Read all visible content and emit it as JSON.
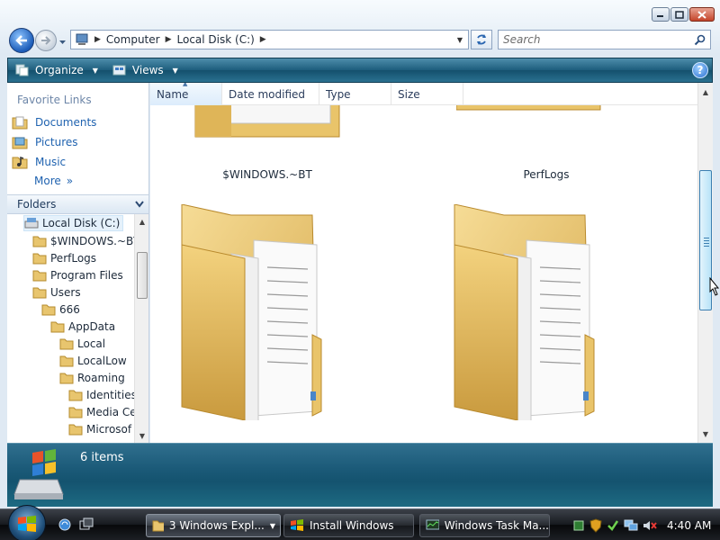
{
  "window": {
    "caption_buttons": [
      "minimize-icon",
      "maximize-icon",
      "close-icon"
    ]
  },
  "address_bar": {
    "crumbs": [
      "Computer",
      "Local Disk (C:)"
    ],
    "icon": "computer-icon"
  },
  "search": {
    "placeholder": "Search"
  },
  "command_bar": {
    "organize": "Organize",
    "views": "Views",
    "help": "?"
  },
  "nav_pane": {
    "favorites_title": "Favorite Links",
    "favorites": [
      {
        "label": "Documents",
        "icon": "documents-icon"
      },
      {
        "label": "Pictures",
        "icon": "pictures-icon"
      },
      {
        "label": "Music",
        "icon": "music-icon"
      }
    ],
    "more": "More",
    "folders_title": "Folders",
    "tree": [
      {
        "label": "Local Disk (C:)",
        "icon": "drive-icon",
        "level": 0,
        "selected": true
      },
      {
        "label": "$WINDOWS.~BT",
        "level": 1
      },
      {
        "label": "PerfLogs",
        "level": 1
      },
      {
        "label": "Program Files",
        "level": 1
      },
      {
        "label": "Users",
        "level": 1
      },
      {
        "label": "666",
        "level": 2
      },
      {
        "label": "AppData",
        "level": 3
      },
      {
        "label": "Local",
        "level": 4
      },
      {
        "label": "LocalLow",
        "level": 4
      },
      {
        "label": "Roaming",
        "level": 4
      },
      {
        "label": "Identities",
        "level": 5
      },
      {
        "label": "Media Ce",
        "level": 5
      },
      {
        "label": "Microsof",
        "level": 5
      }
    ]
  },
  "content": {
    "columns": [
      "Name",
      "Date modified",
      "Type",
      "Size"
    ],
    "sorted_column": "Name",
    "items": [
      {
        "label": "$WINDOWS.~BT"
      },
      {
        "label": "PerfLogs"
      },
      {
        "label": ""
      },
      {
        "label": ""
      }
    ]
  },
  "details_pane": {
    "count": "6 items"
  },
  "taskbar": {
    "buttons": [
      {
        "label": "3 Windows Expl...",
        "icon": "folder-icon",
        "active": true,
        "has_menu": true
      },
      {
        "label": "Install Windows",
        "icon": "windows-flag-icon",
        "active": false
      },
      {
        "label": "Windows Task Ma...",
        "icon": "task-manager-icon",
        "active": false
      }
    ],
    "tray_icons": [
      "network-icon",
      "security-shield-icon",
      "checkmark-icon",
      "network-connection-icon",
      "volume-muted-icon"
    ],
    "clock": "4:40 AM"
  },
  "colors": {
    "command_bar": "#1d5d7c",
    "details_pane": "#1b5a78",
    "link_blue": "#2063b0",
    "folder_yellow": "#e9c46a"
  }
}
